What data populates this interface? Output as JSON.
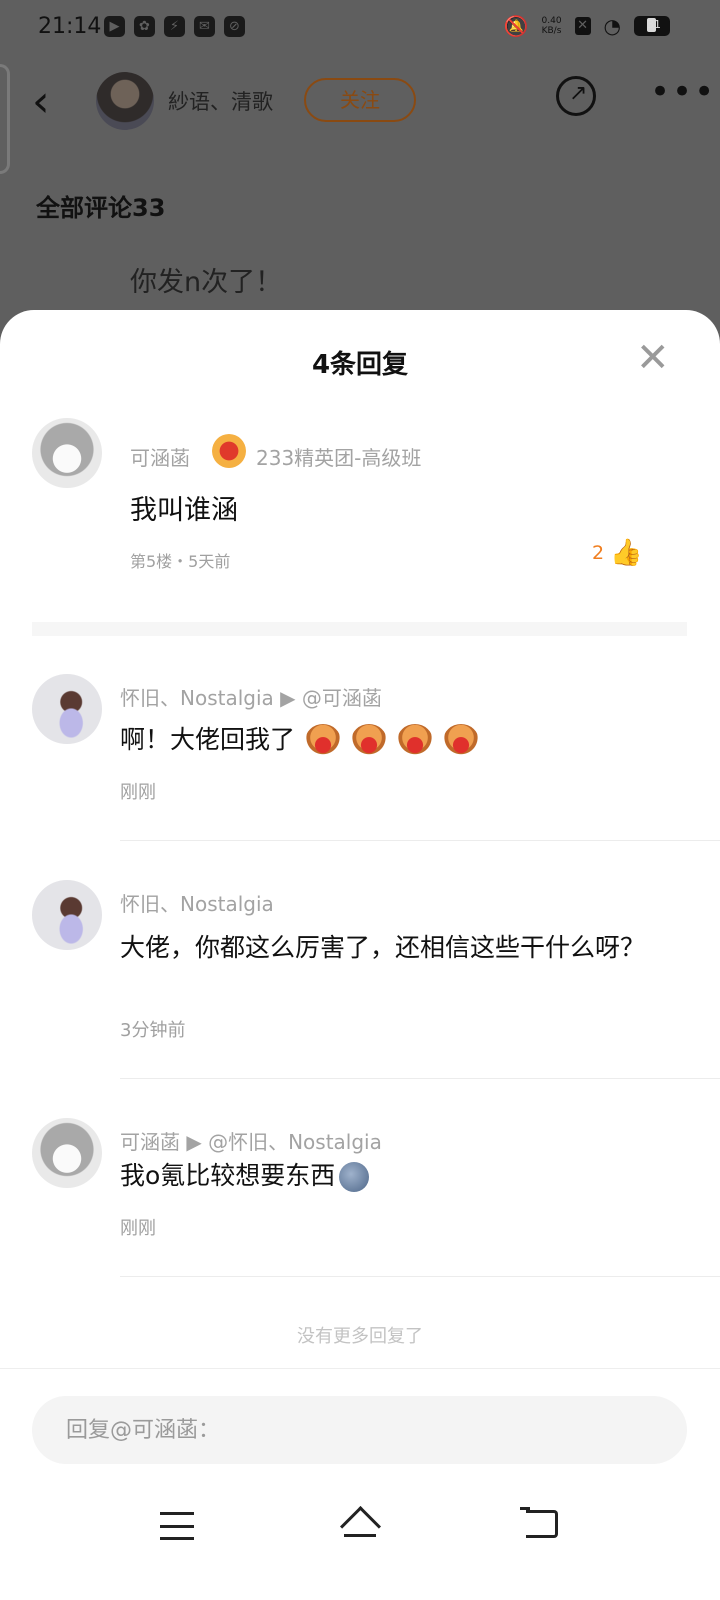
{
  "status_bar": {
    "time": "21:14",
    "app_icons": [
      "▶",
      "✿",
      "⚡",
      "✉",
      "⊘"
    ],
    "net_speed_value": "0.40",
    "net_speed_unit": "KB/s",
    "battery": "31",
    "battery_level": 0.31
  },
  "header": {
    "back_glyph": "‹",
    "author_name": "紗语、清歌",
    "follow_label": "关注",
    "more_glyph": "•••"
  },
  "background": {
    "all_comments_label": "全部评论33",
    "comment_text": "你发n次了！"
  },
  "sheet": {
    "title": "4条回复",
    "close_glyph": "✕",
    "parent": {
      "name": "可涵菡",
      "badge_text": "233精英团-高级班",
      "text": "我叫谁涵",
      "meta": "第5楼・5天前",
      "likes": "2"
    },
    "replies": [
      {
        "name": "怀旧、Nostalgia ▶ @可涵菡",
        "text": "啊！大佬回我了",
        "time": "刚刚"
      },
      {
        "name": "怀旧、Nostalgia",
        "text": "大佬，你都这么厉害了，还相信这些干什么呀？",
        "time": "3分钟前"
      },
      {
        "name": "可涵菡 ▶ @怀旧、Nostalgia",
        "text": "我o氪比较想要东西",
        "time": "刚刚"
      }
    ],
    "no_more": "没有更多回复了",
    "input_placeholder": "回复@可涵菡："
  },
  "colors": {
    "accent": "#f07e1f",
    "follow": "#8a4a12",
    "overlay": "#5f5f5f"
  }
}
